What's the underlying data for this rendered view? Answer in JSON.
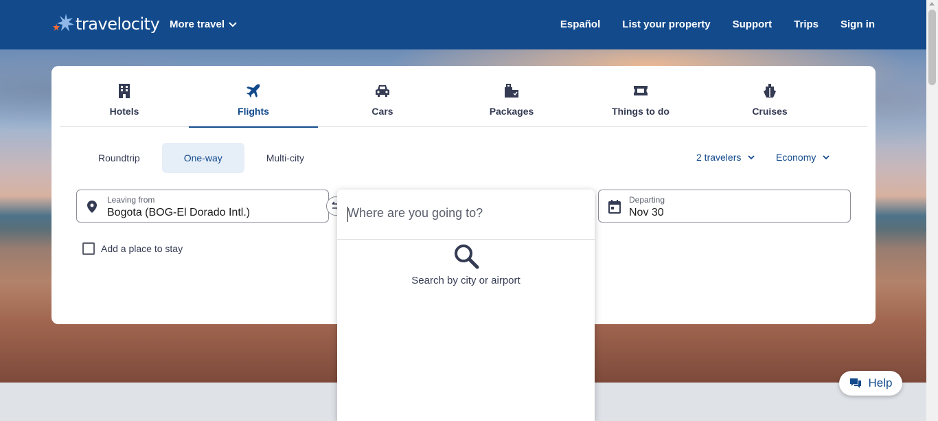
{
  "header": {
    "logo_text": "travelocity",
    "more_travel_label": "More travel",
    "nav": [
      "Español",
      "List your property",
      "Support",
      "Trips",
      "Sign in"
    ]
  },
  "tabs": [
    {
      "label": "Hotels",
      "icon": "hotel-icon"
    },
    {
      "label": "Flights",
      "icon": "plane-icon",
      "active": true
    },
    {
      "label": "Cars",
      "icon": "car-icon"
    },
    {
      "label": "Packages",
      "icon": "packages-icon"
    },
    {
      "label": "Things to do",
      "icon": "ticket-icon"
    },
    {
      "label": "Cruises",
      "icon": "cruise-icon"
    }
  ],
  "trip_types": {
    "roundtrip": "Roundtrip",
    "oneway": "One-way",
    "multicity": "Multi-city",
    "selected": "One-way"
  },
  "options": {
    "travelers": "2 travelers",
    "cabin": "Economy"
  },
  "leaving": {
    "label": "Leaving from",
    "value": "Bogota (BOG-El Dorado Intl.)"
  },
  "departing": {
    "label": "Departing",
    "value": "Nov 30"
  },
  "add_stay_label": "Add a place to stay",
  "destination": {
    "placeholder": "Where are you going to?",
    "value": "",
    "hint": "Search by city or airport"
  },
  "help_label": "Help",
  "colors": {
    "brand": "#124a8c",
    "selected_bg": "#e6eef8"
  }
}
